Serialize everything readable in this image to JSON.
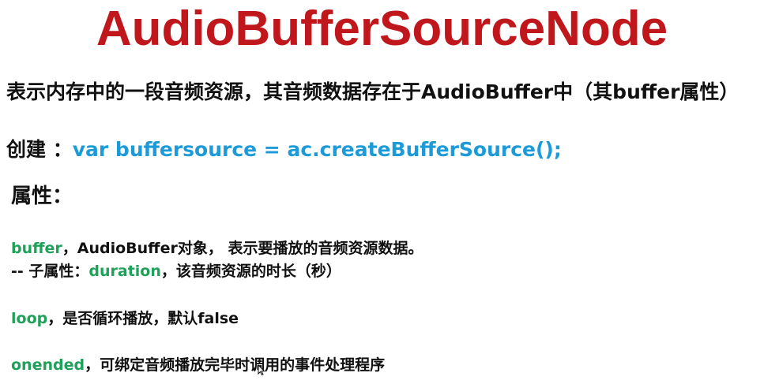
{
  "title": "AudioBufferSourceNode",
  "description": "表示内存中的一段音频资源，其音频数据存在于AudioBuffer中（其buffer属性）",
  "create": {
    "label": "创建 ：",
    "code": "var buffersource = ac.createBufferSource();"
  },
  "properties_heading": "属性：",
  "properties": {
    "buffer": {
      "key": "buffer",
      "text": "，AudioBuffer对象， 表示要播放的音频资源数据。"
    },
    "sub": {
      "prefix": "-- 子属性：",
      "key": "duration",
      "text": "，该音频资源的时长（秒）"
    },
    "loop": {
      "key": "loop",
      "text": "，是否循环播放，默认false"
    },
    "onended": {
      "key": "onended",
      "text": "，可绑定音频播放完毕时调用的事件处理程序"
    }
  },
  "colors": {
    "title": "#c0171d",
    "code": "#1d9bd8",
    "property_key": "#1fa15a",
    "text": "#111111"
  },
  "icons": {
    "cursor": "mouse-pointer-icon"
  }
}
